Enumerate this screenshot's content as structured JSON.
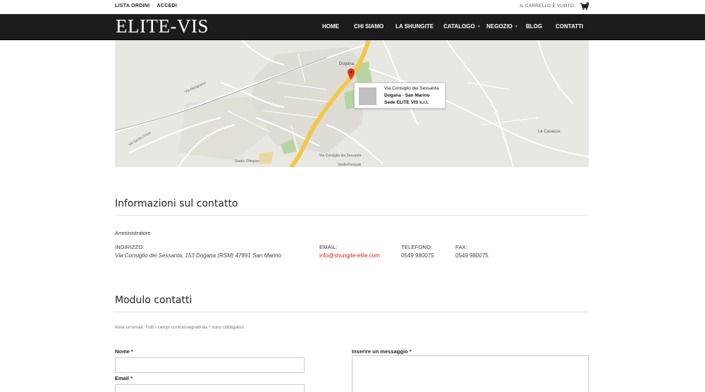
{
  "topbar": {
    "links": [
      "LISTA ORDINI",
      "ACCEDI"
    ],
    "cart_text": "IL CARRELLO È VUOTO",
    "cart_count": "0"
  },
  "header": {
    "logo": "ELITE-VIS",
    "nav": [
      {
        "label": "HOME",
        "has_submenu": false
      },
      {
        "label": "CHI SIAMO",
        "has_submenu": false
      },
      {
        "label": "LA SHUNGITE",
        "has_submenu": false
      },
      {
        "label": "CATALOGO",
        "has_submenu": true
      },
      {
        "label": "NEGOZIO",
        "has_submenu": true
      },
      {
        "label": "BLOG",
        "has_submenu": false
      },
      {
        "label": "CONTATTI",
        "has_submenu": false
      }
    ]
  },
  "map": {
    "info_line1": "Via Consiglio dei Sessanta",
    "info_line2": "Dogana - San Marino",
    "info_line3": "Sede ELITE VIS s.r.l.",
    "labels": [
      "Dogana",
      "Le Casacce",
      "Via Consiglio dei Sessanta",
      "Stadio Olimpico",
      "StudioPasquali",
      "Via Marignano",
      "Via Santa Croce"
    ]
  },
  "contact_info": {
    "title": "Informazioni sul contatto",
    "role": "Amministratore",
    "address_label": "INDIRIZZO:",
    "address_value": "Via Consiglio dei Sessanta, 153 Dogana (RSM) 47891 San Marino",
    "email_label": "EMAIL:",
    "email_value": "info@shungite-elite.com",
    "phone_label": "TELEFONO:",
    "phone_value": "0549 980075",
    "fax_label": "FAX:",
    "fax_value": "0549 980075"
  },
  "contact_form": {
    "title": "Modulo contatti",
    "note": "Invia un'email. Tutti i campi contrassegnati da * sono obbligatori.",
    "name_label": "Nome *",
    "email_label": "Email *",
    "message_label": "Inserire un messaggio *"
  },
  "colors": {
    "nav_bg": "#1c1c1c",
    "link_red": "#d9261c",
    "map_road_yellow": "#f2c84b"
  }
}
